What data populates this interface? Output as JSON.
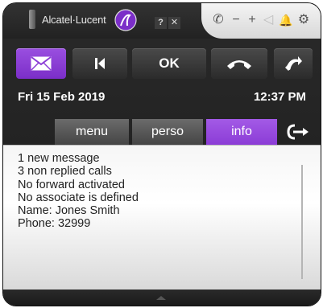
{
  "header": {
    "brand": "Alcatel·Lucent",
    "help_label": "?",
    "close_label": "✕",
    "tray_icons": [
      "phone-icon",
      "minimize-icon",
      "maximize-icon",
      "volume-icon",
      "bell-icon",
      "gear-icon"
    ],
    "tray_glyphs": {
      "phone": "✆",
      "minus": "−",
      "plus": "+",
      "volume": "◁",
      "bell": "🔔",
      "gear": "⚙"
    }
  },
  "toolbar": {
    "ok_label": "OK"
  },
  "datetime": {
    "date": "Fri 15 Feb 2019",
    "time": "12:37 PM"
  },
  "tabs": [
    {
      "label": "menu",
      "active": false
    },
    {
      "label": "perso",
      "active": false
    },
    {
      "label": "info",
      "active": true
    }
  ],
  "info": {
    "lines": [
      "1 new message",
      "3 non replied calls",
      "No forward activated",
      "No associate is defined",
      "Name: Jones Smith",
      "Phone: 32999"
    ]
  },
  "colors": {
    "accent": "#8b3cd6",
    "dark": "#222222"
  }
}
